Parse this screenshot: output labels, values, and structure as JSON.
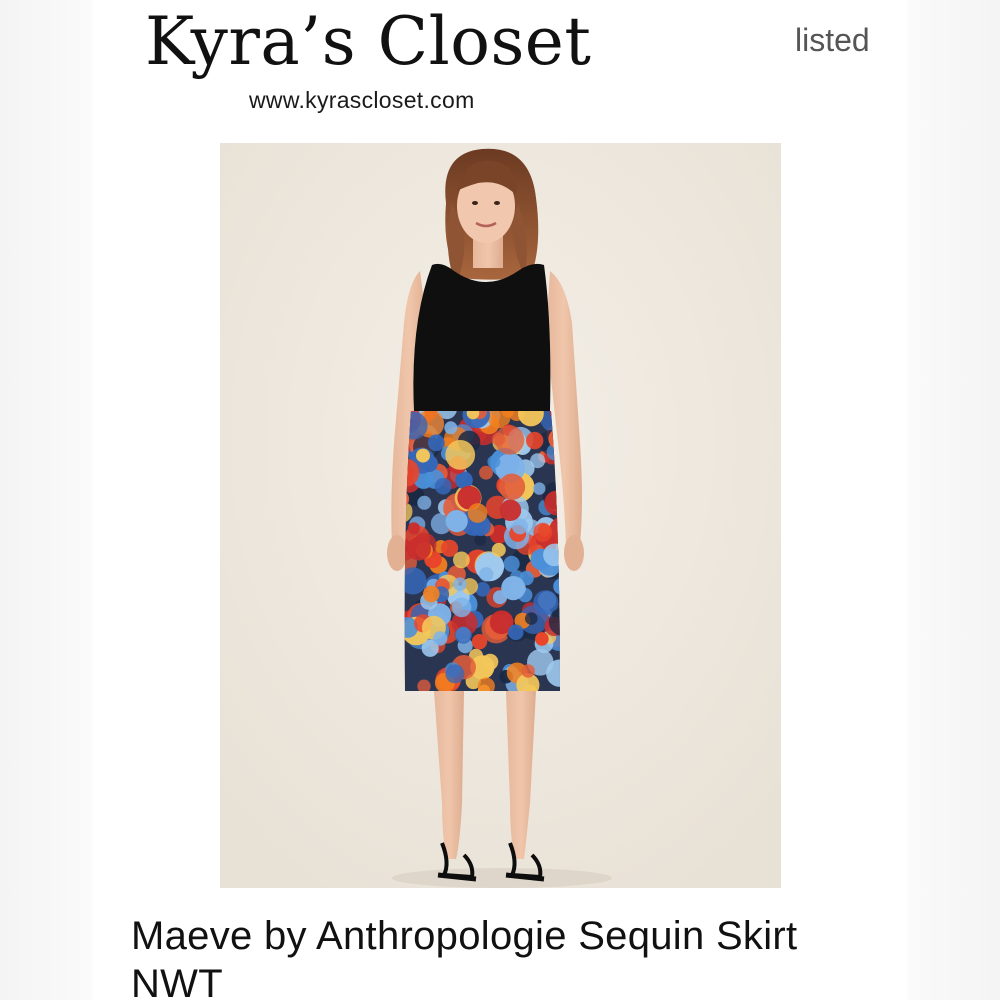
{
  "brand": {
    "name": "Kyra’s Closet",
    "url": "www.kyrascloset.com"
  },
  "listing": {
    "status": "listed",
    "title": "Maeve by Anthropologie Sequin Skirt NWT",
    "photo_icon": "product-photo"
  },
  "colors": {
    "background": "#ffffff",
    "photo_background": "#eee8df",
    "text": "#111111",
    "status_text": "#555555"
  }
}
